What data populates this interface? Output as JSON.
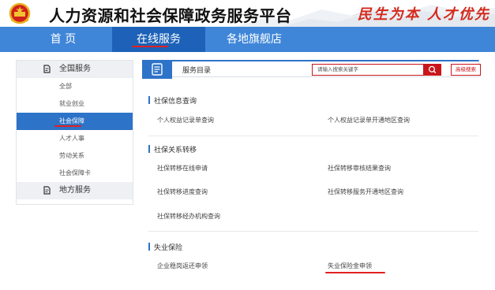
{
  "header": {
    "site_title": "人力资源和社会保障政务服务平台",
    "slogan": "民生为本 人才优先",
    "emblem_icon": "national-emblem-icon",
    "backdrop_icon": "great-wall-mountain-icon"
  },
  "nav": {
    "items": [
      {
        "label": "首 页",
        "active": false
      },
      {
        "label": "在线服务",
        "active": true
      },
      {
        "label": "各地旗舰店",
        "active": false
      }
    ]
  },
  "sidebar": {
    "national": {
      "label": "全国服务",
      "icon": "service-stamp-icon"
    },
    "items": [
      {
        "label": "全部",
        "active": false
      },
      {
        "label": "就业创业",
        "active": false
      },
      {
        "label": "社会保障",
        "active": true
      },
      {
        "label": "人才人事",
        "active": false
      },
      {
        "label": "劳动关系",
        "active": false
      },
      {
        "label": "社会保障卡",
        "active": false
      }
    ],
    "local": {
      "label": "地方服务",
      "icon": "service-stamp-icon"
    }
  },
  "main": {
    "header_icon": "document-icon",
    "title": "服务目录",
    "search": {
      "placeholder": "请输入搜索关键字",
      "icon": "search-icon"
    },
    "advanced_search_label": "高级搜索"
  },
  "sections": [
    {
      "title": "社保信息查询",
      "links": [
        "个人权益记录单查询",
        "个人权益记录单开通地区查询"
      ]
    },
    {
      "title": "社保关系转移",
      "links": [
        "社保转移在线申请",
        "社保转移审核结果查询",
        "社保转移进度查询",
        "社保转移服务开通地区查询",
        "社保转移经办机构查询"
      ]
    },
    {
      "title": "失业保险",
      "links": [
        "企业稳岗返还申领",
        "失业保险金申领"
      ]
    }
  ],
  "colors": {
    "nav_blue": "#3f86d8",
    "nav_active": "#1d62b8",
    "accent_blue": "#2d73c8",
    "brand_red": "#c9161c",
    "annotation_red": "#e02020"
  }
}
